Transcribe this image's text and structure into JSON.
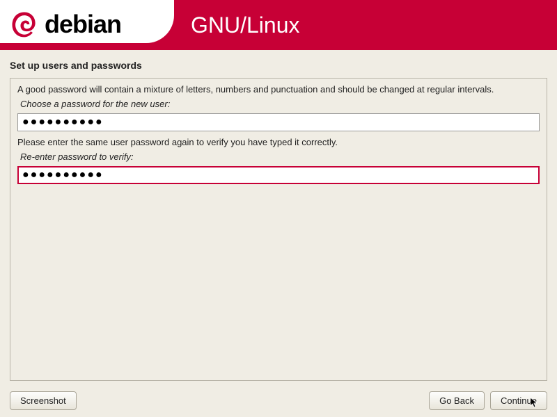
{
  "header": {
    "brand": "debian",
    "subtitle": "GNU/Linux"
  },
  "page": {
    "title": "Set up users and passwords",
    "help_text": "A good password will contain a mixture of letters, numbers and punctuation and should be changed at regular intervals.",
    "field1_label": "Choose a password for the new user:",
    "field1_value": "●●●●●●●●●●",
    "verify_text": "Please enter the same user password again to verify you have typed it correctly.",
    "field2_label": "Re-enter password to verify:",
    "field2_value": "●●●●●●●●●●"
  },
  "buttons": {
    "screenshot": "Screenshot",
    "go_back": "Go Back",
    "continue": "Continue"
  },
  "colors": {
    "brand": "#c70036"
  }
}
